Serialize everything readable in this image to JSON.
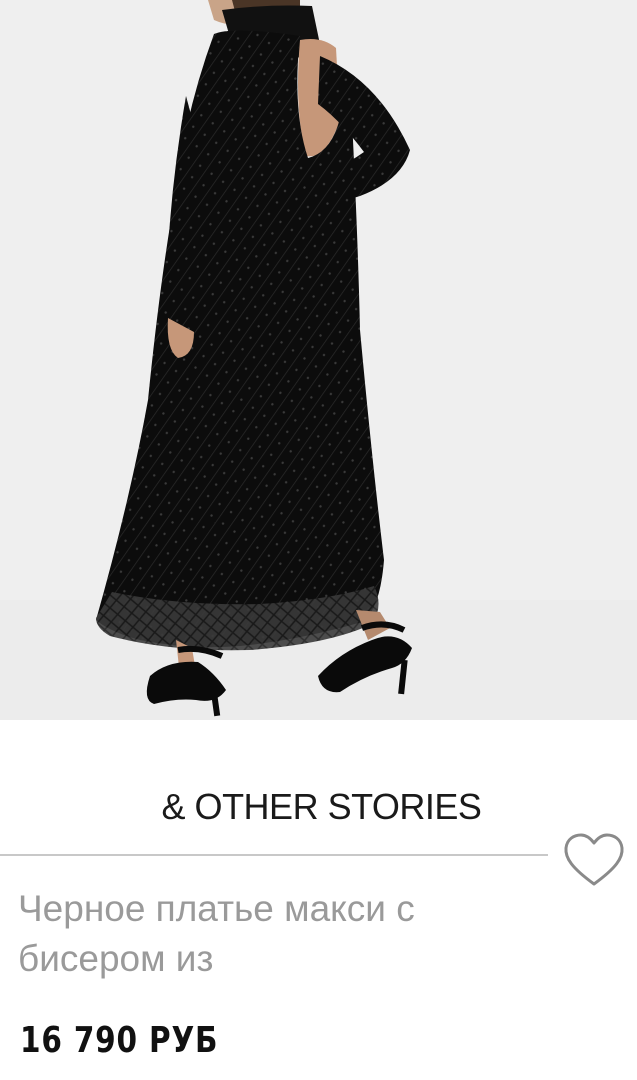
{
  "product": {
    "brand": "& OTHER STORIES",
    "title": "Черное платье макси с бисером из",
    "price": "16 790 РУБ"
  },
  "icons": {
    "wishlist": "heart-outline-icon"
  },
  "colors": {
    "image_background": "#efefef",
    "brand_text": "#1a1a1a",
    "title_text": "#9a9a9a",
    "price_text": "#111111",
    "divider": "#c8c8c8",
    "heart_stroke": "#8a8a8a"
  }
}
